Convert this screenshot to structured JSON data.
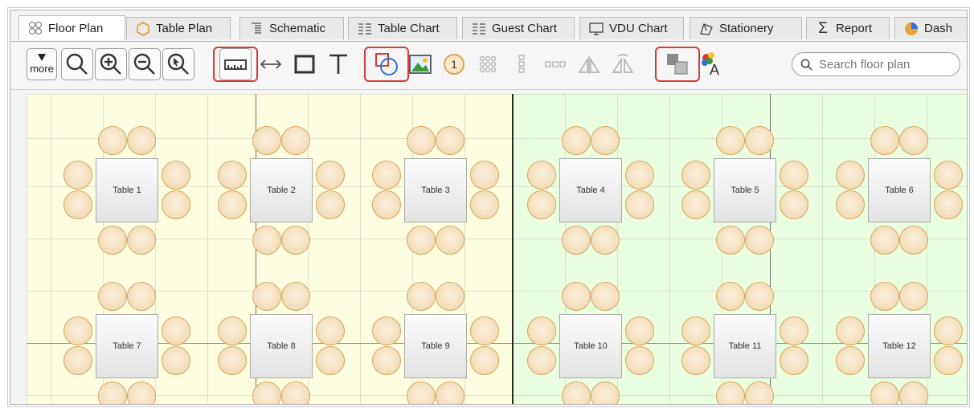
{
  "tabs": [
    {
      "label": "Floor Plan",
      "icon": "floor-plan-icon",
      "active": true
    },
    {
      "label": "Table Plan",
      "icon": "table-plan-icon"
    },
    {
      "label": "Schematic",
      "icon": "schematic-icon"
    },
    {
      "label": "Table Chart",
      "icon": "table-chart-icon"
    },
    {
      "label": "Guest Chart",
      "icon": "guest-chart-icon"
    },
    {
      "label": "VDU Chart",
      "icon": "monitor-icon"
    },
    {
      "label": "Stationery",
      "icon": "stationery-icon"
    },
    {
      "label": "Report",
      "icon": "sigma-icon"
    },
    {
      "label": "Dash",
      "icon": "pie-icon"
    }
  ],
  "toolbar": {
    "more_label": "more",
    "search_placeholder": "Search floor plan",
    "buttons": [
      "zoom",
      "zoom-in",
      "zoom-out",
      "zoom-to-selection",
      "measure",
      "dimension",
      "rectangle",
      "text",
      "shapes",
      "image",
      "numbered-marker",
      "grid-arrange",
      "column-arrange",
      "row-arrange",
      "mirror-horizontal",
      "mirror-vertical",
      "group",
      "color-text"
    ],
    "highlighted": [
      "measure",
      "shapes",
      "group"
    ]
  },
  "tables": [
    {
      "label": "Table 1"
    },
    {
      "label": "Table 2"
    },
    {
      "label": "Table 3"
    },
    {
      "label": "Table 4"
    },
    {
      "label": "Table 5"
    },
    {
      "label": "Table 6"
    },
    {
      "label": "Table 7"
    },
    {
      "label": "Table 8"
    },
    {
      "label": "Table 9"
    },
    {
      "label": "Table 10"
    },
    {
      "label": "Table 11"
    },
    {
      "label": "Table 12"
    }
  ],
  "colors": {
    "zone_left": "#fdfde0",
    "zone_right": "#eaffdf",
    "highlight": "#d43b3b",
    "seat_border": "#d8a55c",
    "accent_blue": "#2f6fd6"
  }
}
